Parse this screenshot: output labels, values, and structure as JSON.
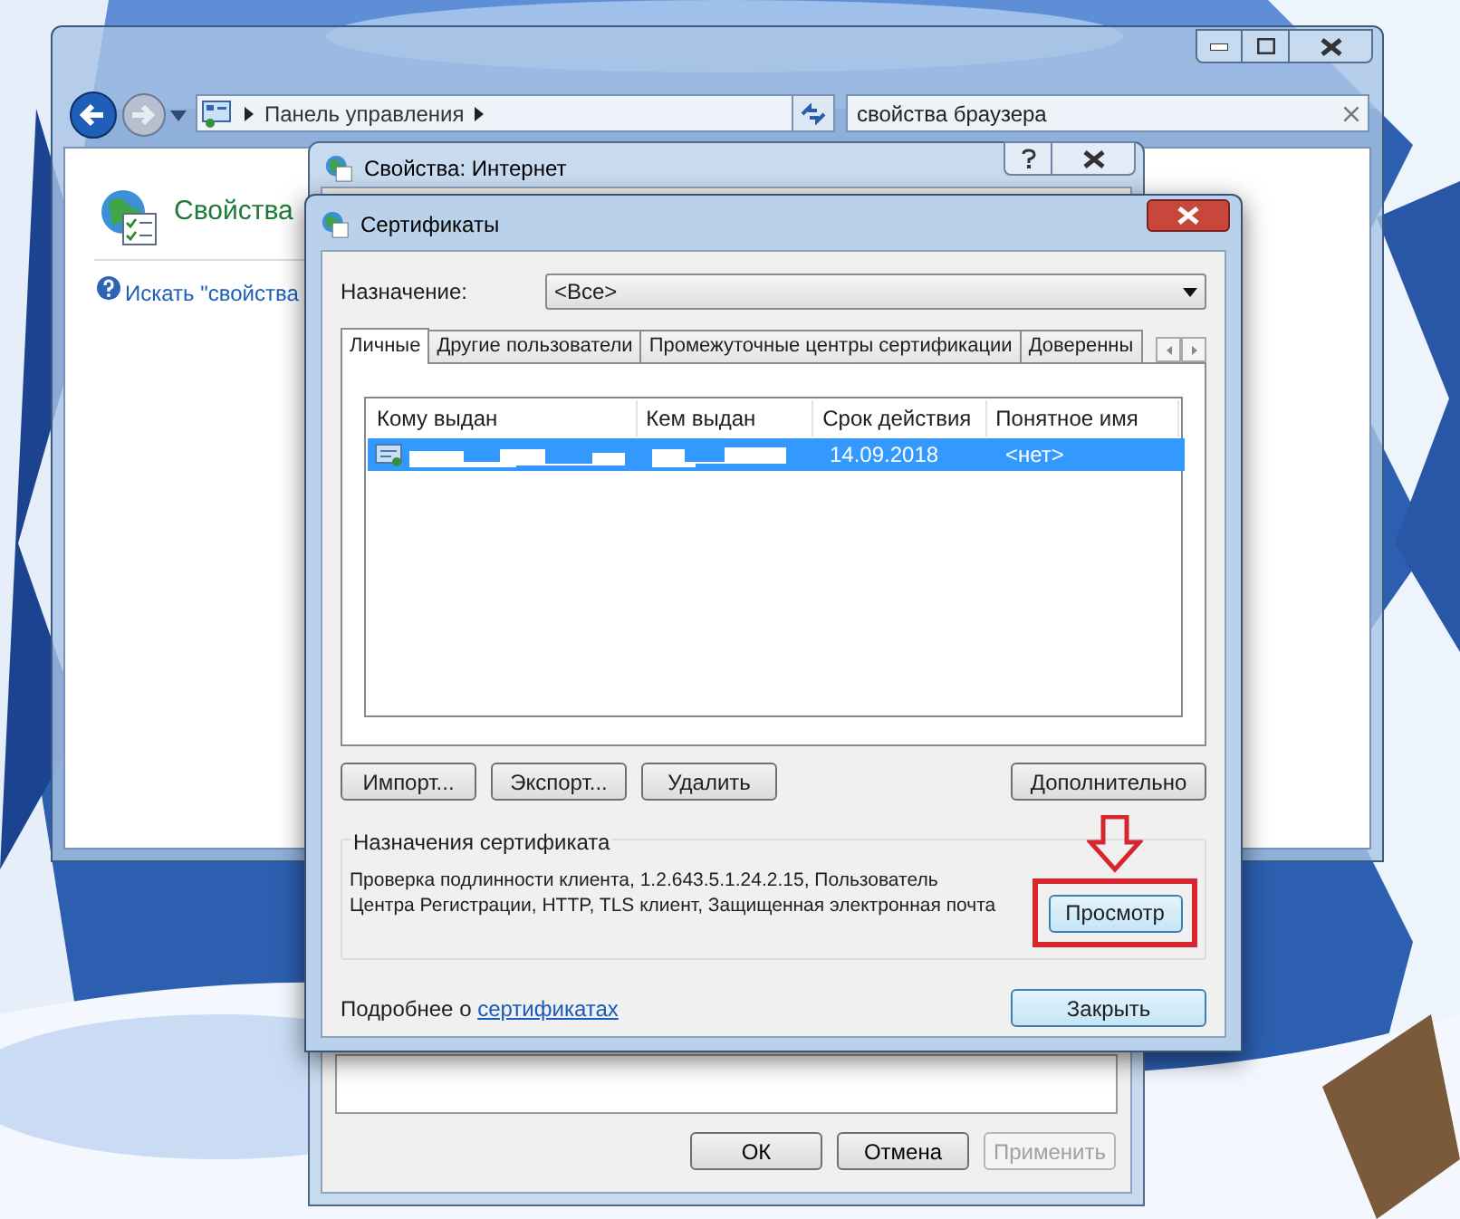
{
  "explorer": {
    "address_path": [
      "Панель управления"
    ],
    "search": {
      "value": "свойства браузера"
    },
    "heading": "Свойства",
    "search_link": "Искать \"свойства"
  },
  "internet_options": {
    "title": "Свойства: Интернет",
    "buttons": [
      {
        "label": "ОК",
        "disabled": false
      },
      {
        "label": "Отмена",
        "disabled": false
      },
      {
        "label": "Применить",
        "disabled": true
      }
    ]
  },
  "certificates": {
    "title": "Сертификаты",
    "purpose_label": "Назначение:",
    "purpose_value": "<Все>",
    "tabs": [
      {
        "label": "Личные",
        "selected": true
      },
      {
        "label": "Другие пользователи",
        "selected": false
      },
      {
        "label": "Промежуточные центры сертификации",
        "selected": false
      },
      {
        "label": "Доверенны",
        "selected": false
      }
    ],
    "columns": [
      "Кому выдан",
      "Кем выдан",
      "Срок действия",
      "Понятное имя"
    ],
    "rows": [
      {
        "expiration": "14.09.2018",
        "friendly_name": "<нет>",
        "selected": true
      }
    ],
    "action_buttons": [
      "Импорт...",
      "Экспорт...",
      "Удалить"
    ],
    "advanced_button": "Дополнительно",
    "purposes_group": {
      "title": "Назначения сертификата",
      "lines": [
        "Проверка подлинности клиента, 1.2.643.5.1.24.2.15, Пользователь",
        "Центра Регистрации, HTTP, TLS клиент, Защищенная электронная почта"
      ],
      "view_button": {
        "label": "Просмотр",
        "highlighted": true
      }
    },
    "footer": {
      "text": "Подробнее о",
      "link": "сертификатах"
    },
    "close_button": "Закрыть"
  }
}
